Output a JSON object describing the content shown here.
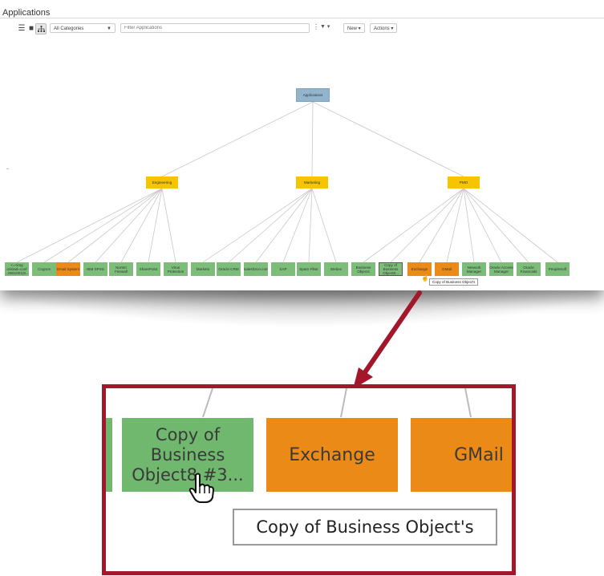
{
  "app": {
    "title": "Applications"
  },
  "toolbar": {
    "view_icons": [
      "list-view-icon",
      "folder-view-icon",
      "tree-view-icon"
    ],
    "category_select": "All Categories",
    "filter_placeholder": "Filter Applications",
    "more_glyph": "⋮",
    "filter_glyph": "▼",
    "new_button": "New",
    "actions_button": "Actions"
  },
  "tree": {
    "root": "Applications",
    "categories": [
      "Engineering",
      "Marketing",
      "PMO"
    ],
    "leaves": [
      {
        "label": "<=<img onload=conf ...0661001(8...",
        "color": "green"
      },
      {
        "label": "Cognos",
        "color": "green"
      },
      {
        "label": "Email System",
        "color": "orange"
      },
      {
        "label": "IBM SPSS",
        "color": "green"
      },
      {
        "label": "Norton Firewall",
        "color": "green"
      },
      {
        "label": "SharePoint",
        "color": "green"
      },
      {
        "label": "Virus Protection",
        "color": "green"
      },
      {
        "label": "Marketo",
        "color": "green"
      },
      {
        "label": "Oracle CRM",
        "color": "green"
      },
      {
        "label": "Salesforce.com",
        "color": "green"
      },
      {
        "label": "SAP",
        "color": "green"
      },
      {
        "label": "Spam Filter",
        "color": "green"
      },
      {
        "label": "Webex",
        "color": "green"
      },
      {
        "label": "Business Objects",
        "color": "green"
      },
      {
        "label": "Copy of Business Object8...",
        "color": "green"
      },
      {
        "label": "Exchange",
        "color": "orange"
      },
      {
        "label": "GMail",
        "color": "orange"
      },
      {
        "label": "Network Manager",
        "color": "green"
      },
      {
        "label": "Oracle Access Manager",
        "color": "green"
      },
      {
        "label": "Oracle Financials",
        "color": "green"
      },
      {
        "label": "PeopleSoft",
        "color": "green"
      }
    ],
    "tooltip": "Copy of Business Object's"
  },
  "zoom": {
    "node_copy_line1": "Copy of",
    "node_copy_line2": "Business",
    "node_copy_line3": "Object8 #3...",
    "node_exchange": "Exchange",
    "node_gmail": "GMail",
    "tooltip": "Copy of Business Object's"
  },
  "colors": {
    "root": "#92b4cc",
    "category": "#f6c400",
    "leaf_green": "#7cbd7a",
    "leaf_orange": "#ec8a18",
    "callout_red": "#a3172a"
  }
}
